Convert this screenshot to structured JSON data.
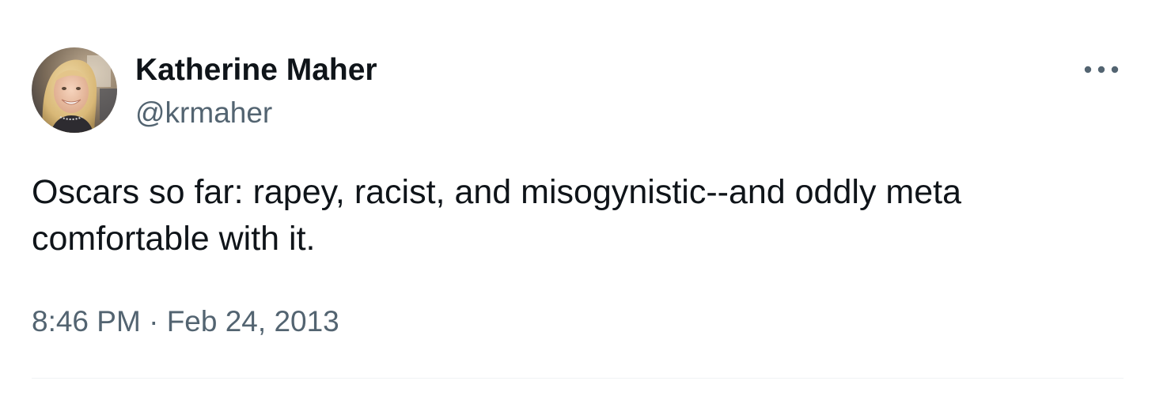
{
  "tweet": {
    "author": {
      "display_name": "Katherine Maher",
      "handle": "@krmaher",
      "avatar_icon": "profile-photo"
    },
    "more_icon": "ellipsis-icon",
    "text": "Oscars so far: rapey, racist, and misogynistic--and oddly meta\ncomfortable with it.",
    "time": "8:46 PM",
    "separator": "·",
    "date": "Feb 24, 2013"
  },
  "colors": {
    "primary_text": "#0f1419",
    "secondary_text": "#536471",
    "divider": "#eff3f4",
    "background": "#ffffff"
  }
}
